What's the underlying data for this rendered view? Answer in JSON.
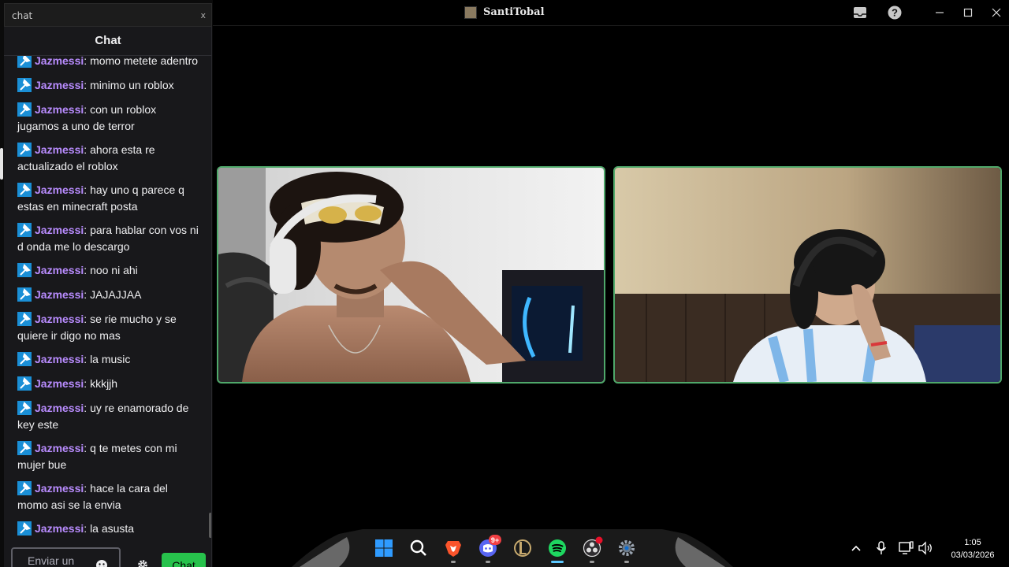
{
  "chat_window": {
    "title": "chat",
    "close_label": "x",
    "header": "Chat",
    "messages": [
      {
        "user": "Jazmessi",
        "text": "momo metete adentro"
      },
      {
        "user": "Jazmessi",
        "text": "minimo un roblox"
      },
      {
        "user": "Jazmessi",
        "text": "con un roblox jugamos a uno de terror"
      },
      {
        "user": "Jazmessi",
        "text": "ahora esta re actualizado el roblox"
      },
      {
        "user": "Jazmessi",
        "text": "hay uno q parece q estas en minecraft posta"
      },
      {
        "user": "Jazmessi",
        "text": "para hablar con vos ni d onda me lo descargo"
      },
      {
        "user": "Jazmessi",
        "text": "noo ni ahi"
      },
      {
        "user": "Jazmessi",
        "text": "JAJAJJAA"
      },
      {
        "user": "Jazmessi",
        "text": "se rie mucho y se quiere ir digo no mas"
      },
      {
        "user": "Jazmessi",
        "text": "la music"
      },
      {
        "user": "Jazmessi",
        "text": "kkkjjh"
      },
      {
        "user": "Jazmessi",
        "text": "uy re enamorado de key este"
      },
      {
        "user": "Jazmessi",
        "text": "q te metes con mi mujer bue"
      },
      {
        "user": "Jazmessi",
        "text": "hace la cara del momo asi se la envia"
      },
      {
        "user": "Jazmessi",
        "text": "la asusta"
      }
    ],
    "input_placeholder": "Enviar un",
    "send_label": "Chat",
    "username_color": "#b98cff",
    "badge_color": "#1a8fd6",
    "send_color": "#27c24c"
  },
  "main_window": {
    "title": "SantiTobal",
    "titlebar_icons": [
      "inbox-icon",
      "help-icon",
      "minimize-icon",
      "maximize-icon",
      "close-icon"
    ],
    "tile_border_color": "#4fa86a"
  },
  "taskbar": {
    "apps": [
      "windows-start-icon",
      "search-icon",
      "brave-browser-icon",
      "discord-icon",
      "league-of-legends-icon",
      "spotify-icon",
      "obs-icon",
      "settings-icon"
    ],
    "discord_badge": "9+",
    "tray_icons": [
      "show-hidden-icons-chevron",
      "microphone-icon",
      "network-icon",
      "volume-icon"
    ],
    "time": "1:05",
    "date": "03/03/2026"
  }
}
